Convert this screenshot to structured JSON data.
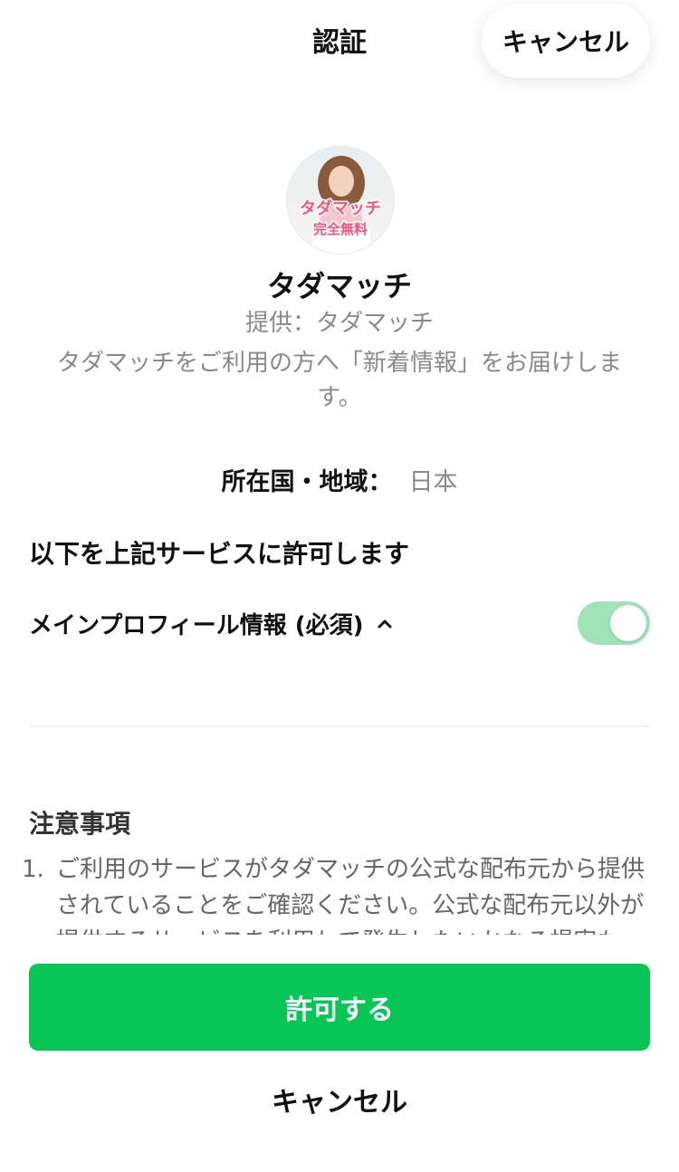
{
  "header": {
    "title": "認証",
    "cancel_label": "キャンセル"
  },
  "app": {
    "avatar_text_line1": "タダマッチ",
    "avatar_text_line2": "完全無料",
    "name": "タダマッチ",
    "provider": "提供：タダマッチ",
    "description": "タダマッチをご利用の方へ「新着情報」をお届けします。"
  },
  "region": {
    "label": "所在国・地域：",
    "value": "日本"
  },
  "permissions": {
    "heading": "以下を上記サービスに許可します",
    "profile_label": "メインプロフィール情報 (必須)",
    "profile_enabled": true
  },
  "notes": {
    "title": "注意事項",
    "items": [
      {
        "number": "1.",
        "text": "ご利用のサービスがタダマッチの公式な配布元から提供されていることをご確認ください。公式な配布元以外が提供するサービスを利用して発生したいかなる損害も"
      }
    ]
  },
  "actions": {
    "allow_label": "許可する",
    "cancel_label": "キャンセル"
  },
  "colors": {
    "accent": "#06c755",
    "toggle_on": "#9fe3b6",
    "muted_text": "#8a8a8a"
  }
}
